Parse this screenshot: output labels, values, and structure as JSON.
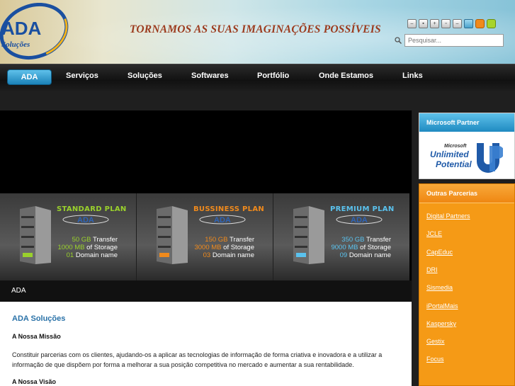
{
  "header": {
    "logo_text": "ADA",
    "logo_subtext": "Soluções",
    "slogan": "TORNAMOS AS SUAS IMAGINAÇÕES POSSÍVEIS",
    "search_placeholder": "Pesquisar...",
    "toolbar_icons": [
      "minus-icon",
      "image-icon",
      "plus-icon",
      "reset-icon",
      "minus-icon",
      "layout-icon",
      "orange-theme-icon",
      "green-theme-icon"
    ],
    "theme_colors": {
      "orange": "#f08a1c",
      "green": "#a7d42c",
      "blue": "#4aa3cc"
    }
  },
  "nav": {
    "items": [
      "ADA",
      "Serviços",
      "Soluções",
      "Softwares",
      "Portfólio",
      "Onde Estamos",
      "Links"
    ],
    "active": "ADA"
  },
  "plans": [
    {
      "name": "STANDARD PLAN",
      "transfer_num": "50 GB",
      "transfer_label": "Transfer",
      "storage_num": "1000 MB",
      "storage_label": "of Storage",
      "domain_num": "01",
      "domain_label": "Domain name",
      "logo": "ADA"
    },
    {
      "name": "BUSSINESS PLAN",
      "transfer_num": "150 GB",
      "transfer_label": "Transfer",
      "storage_num": "3000 MB",
      "storage_label": "of Storage",
      "domain_num": "03",
      "domain_label": "Domain name",
      "logo": "ADA"
    },
    {
      "name": "PREMIUM PLAN",
      "transfer_num": "350 GB",
      "transfer_label": "Transfer",
      "storage_num": "9000 MB",
      "storage_label": "of Storage",
      "domain_num": "09",
      "domain_label": "Domain name",
      "logo": "ADA"
    }
  ],
  "breadcrumb": "ADA",
  "content": {
    "heading": "ADA Soluções",
    "mission_title": "A Nossa Missão",
    "mission_text": "Constituir parcerias com os clientes, ajudando-os a aplicar as tecnologias de informação de forma criativa e inovadora e a utilizar a informação de que dispõem por forma a melhorar a sua posição competitiva no mercado e aumentar a sua rentabilidade.",
    "vision_title": "A Nossa Visão"
  },
  "sidebar": {
    "microsoft_title": "Microsoft Partner",
    "microsoft_logo_text_1": "Microsoft",
    "microsoft_logo_text_2": "Unlimited",
    "microsoft_logo_text_3": "Potential",
    "partners_title": "Outras Parcerias",
    "partners": [
      "Digital Partners",
      "JCLE",
      "CapEduc",
      "DRI",
      "Sismedia",
      "iPortalMais",
      "Kaspersky",
      "Gestix",
      "Focus"
    ]
  }
}
